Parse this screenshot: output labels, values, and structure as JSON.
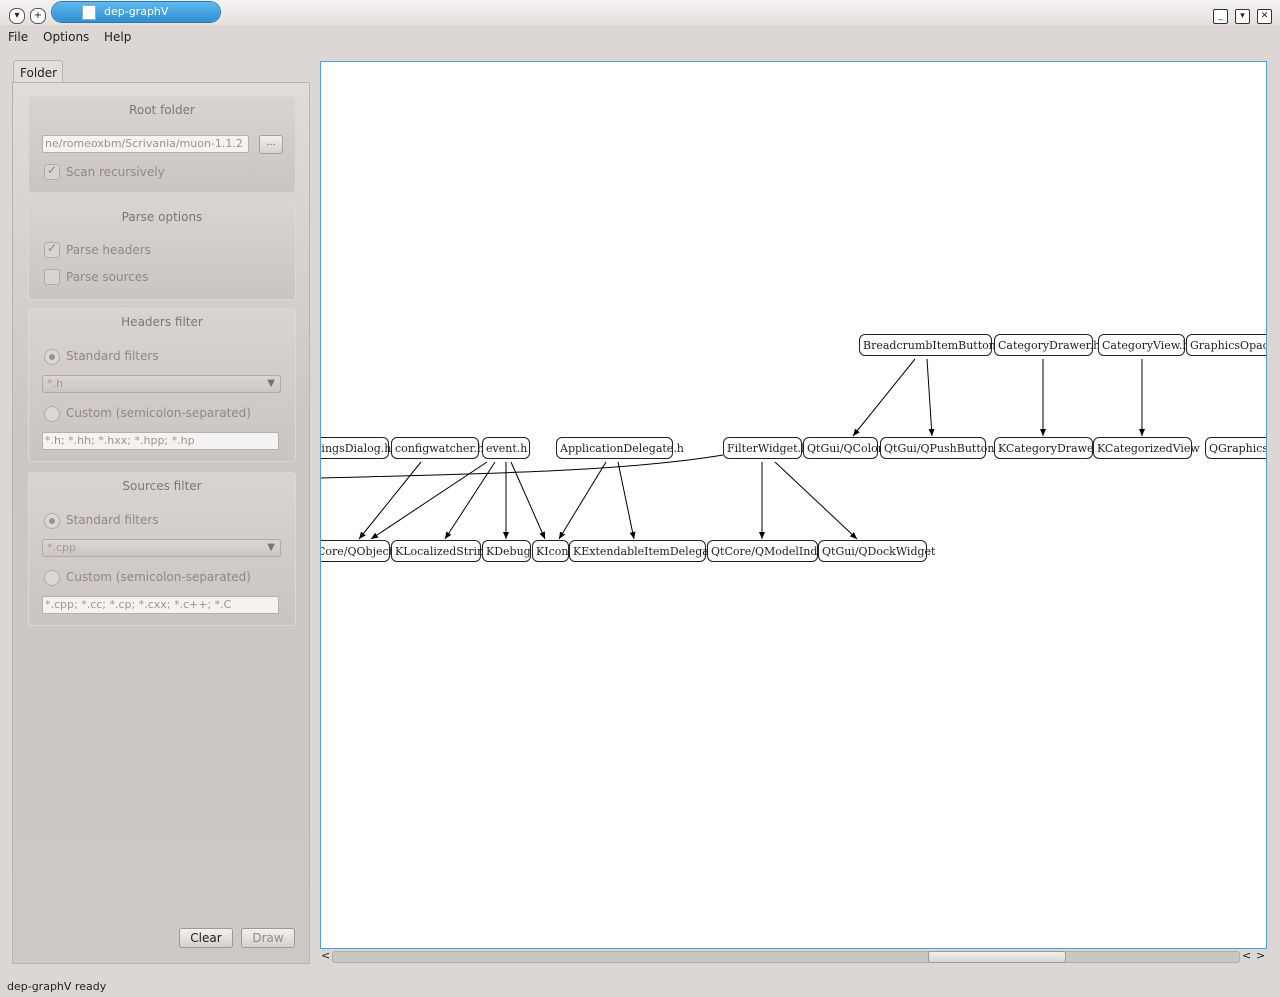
{
  "window": {
    "title": "dep-graphV"
  },
  "menu": [
    "File",
    "Options",
    "Help"
  ],
  "tabs": {
    "folder": "Folder"
  },
  "root_folder": {
    "title": "Root folder",
    "path": "ne/romeoxbm/Scrivania/muon-1.1.2",
    "browse_label": "...",
    "scan_recursively": {
      "label": "Scan recursively",
      "checked": true
    }
  },
  "parse_options": {
    "title": "Parse options",
    "parse_headers": {
      "label": "Parse headers",
      "checked": true
    },
    "parse_sources": {
      "label": "Parse sources",
      "checked": false
    }
  },
  "headers_filter": {
    "title": "Headers filter",
    "standard_label": "Standard filters",
    "standard_value": "*.h",
    "custom_label": "Custom (semicolon-separated)",
    "custom_value": "*.h; *.hh; *.hxx; *.hpp; *.hp"
  },
  "sources_filter": {
    "title": "Sources filter",
    "standard_label": "Standard filters",
    "standard_value": "*.cpp",
    "custom_label": "Custom (semicolon-separated)",
    "custom_value": "*.cpp; *.cc; *.cp; *.cxx; *.c++; *.C"
  },
  "buttons": {
    "clear": "Clear",
    "draw": "Draw"
  },
  "graph": {
    "nodes": [
      "BreadcrumbItemButton.h",
      "CategoryDrawer.h",
      "CategoryView.h",
      "GraphicsOpacity",
      "tingsDialog.h",
      "configwatcher.h",
      "event.h",
      "ApplicationDelegate.h",
      "FilterWidget.h",
      "QtGui/QColor",
      "QtGui/QPushButton",
      "KCategoryDrawer",
      "KCategorizedView",
      "QGraphicsD",
      "Core/QObject",
      "KLocalizedString",
      "KDebug",
      "KIcon",
      "KExtendableItemDelegate",
      "QtCore/QModelIndex",
      "QtGui/QDockWidget"
    ]
  },
  "status": "dep-graphV ready"
}
